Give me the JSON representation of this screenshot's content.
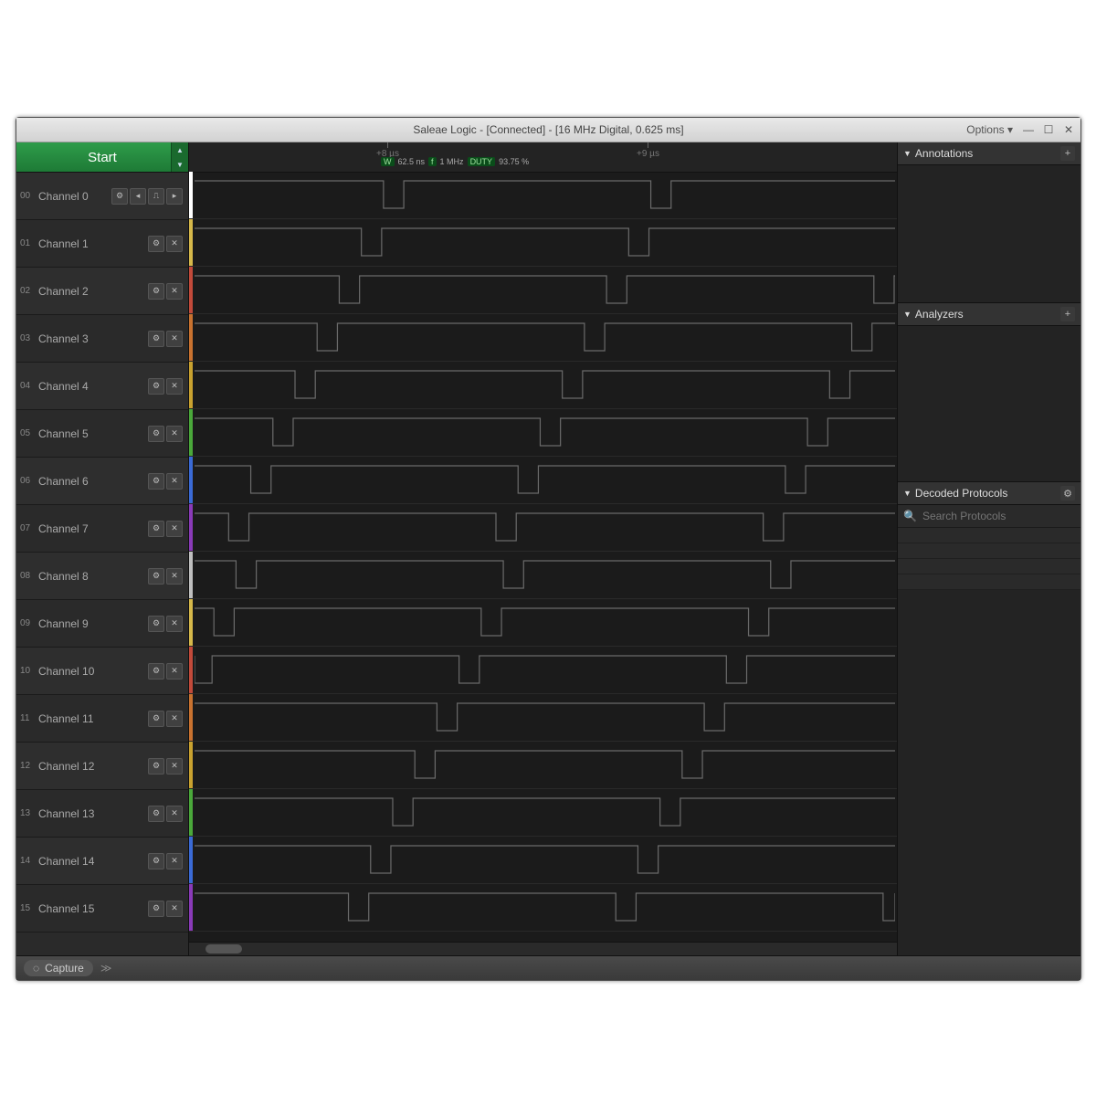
{
  "window": {
    "title": "Saleae Logic - [Connected] - [16 MHz Digital, 0.625 ms]",
    "options_label": "Options ▾",
    "win_min": "—",
    "win_max": "☐",
    "win_close": "✕"
  },
  "start_label": "Start",
  "channels": [
    {
      "idx": "00",
      "name": "Channel 0",
      "color": "#ffffff",
      "trigger": true
    },
    {
      "idx": "01",
      "name": "Channel 1",
      "color": "#d6b84a"
    },
    {
      "idx": "02",
      "name": "Channel 2",
      "color": "#c24a3a"
    },
    {
      "idx": "03",
      "name": "Channel 3",
      "color": "#c9722f"
    },
    {
      "idx": "04",
      "name": "Channel 4",
      "color": "#c9a22f"
    },
    {
      "idx": "05",
      "name": "Channel 5",
      "color": "#4aa83a"
    },
    {
      "idx": "06",
      "name": "Channel 6",
      "color": "#3a6ad6"
    },
    {
      "idx": "07",
      "name": "Channel 7",
      "color": "#8a3ab8"
    },
    {
      "idx": "08",
      "name": "Channel 8",
      "color": "#bfbfbf"
    },
    {
      "idx": "09",
      "name": "Channel 9",
      "color": "#d6b84a"
    },
    {
      "idx": "10",
      "name": "Channel 10",
      "color": "#c24a3a"
    },
    {
      "idx": "11",
      "name": "Channel 11",
      "color": "#c9722f"
    },
    {
      "idx": "12",
      "name": "Channel 12",
      "color": "#c9a22f"
    },
    {
      "idx": "13",
      "name": "Channel 13",
      "color": "#4aa83a"
    },
    {
      "idx": "14",
      "name": "Channel 14",
      "color": "#3a6ad6"
    },
    {
      "idx": "15",
      "name": "Channel 15",
      "color": "#8a3ab8"
    }
  ],
  "timeline": {
    "t1": "+8 µs",
    "t2": "+9 µs",
    "measure": {
      "width": "62.5 ns",
      "freq": "1 MHz",
      "duty": "93.75 %",
      "badge_w": "W",
      "badge_f": "f",
      "badge_d": "DUTY"
    }
  },
  "panels": {
    "annotations": "Annotations",
    "analyzers": "Analyzers",
    "decoded": "Decoded Protocols",
    "search_placeholder": "Search Protocols"
  },
  "bottom": {
    "capture": "Capture"
  },
  "icons": {
    "gear": "⚙",
    "close": "✕",
    "plus": "+",
    "trigger_left": "◂",
    "trigger_u": "⎍",
    "trigger_right": "▸",
    "tri": "▼",
    "search": "🔍",
    "collapse": "≫"
  }
}
